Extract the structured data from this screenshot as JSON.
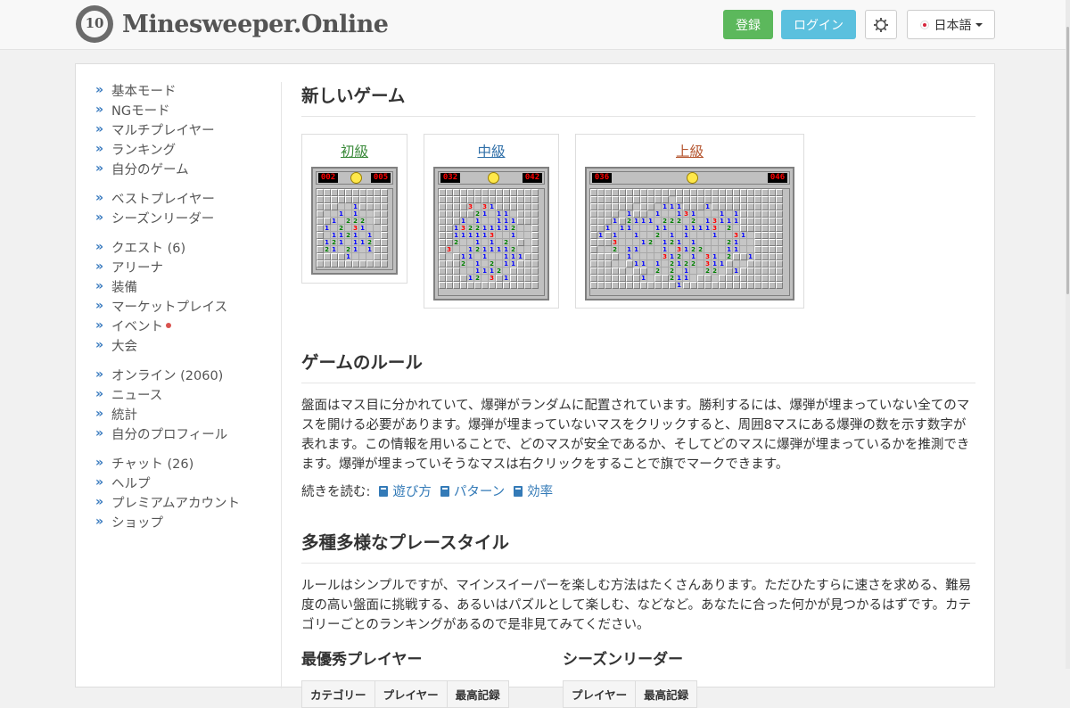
{
  "header": {
    "logo_badge": "10",
    "logo_text": "Minesweeper.Online",
    "register_label": "登録",
    "login_label": "ログイン",
    "theme_icon": "gear-icon",
    "language_label": "日本語"
  },
  "colors": {
    "register": "#5cb85c",
    "login": "#5bc0de",
    "link": "#337ab7",
    "beginner": "#3a8a3a",
    "intermediate": "#2f6fa8",
    "expert": "#b5552f"
  },
  "sidebar": {
    "groups": [
      [
        {
          "label": "基本モード"
        },
        {
          "label": "NGモード"
        },
        {
          "label": "マルチプレイヤー"
        },
        {
          "label": "ランキング"
        },
        {
          "label": "自分のゲーム"
        }
      ],
      [
        {
          "label": "ベストプレイヤー"
        },
        {
          "label": "シーズンリーダー"
        }
      ],
      [
        {
          "label": "クエスト (6)"
        },
        {
          "label": "アリーナ"
        },
        {
          "label": "装備"
        },
        {
          "label": "マーケットプレイス"
        },
        {
          "label": "イベント"
        },
        {
          "label": "大会"
        }
      ],
      [
        {
          "label": "オンライン (2060)"
        },
        {
          "label": "ニュース"
        },
        {
          "label": "統計"
        },
        {
          "label": "自分のプロフィール"
        }
      ],
      [
        {
          "label": "チャット (26)"
        },
        {
          "label": "ヘルプ"
        },
        {
          "label": "プレミアムアカウント"
        },
        {
          "label": "ショップ"
        }
      ]
    ]
  },
  "new_game": {
    "title": "新しいゲーム",
    "beginner": {
      "label": "初級",
      "mines": "002",
      "timer": "005"
    },
    "intermediate": {
      "label": "中級",
      "mines": "032",
      "timer": "042"
    },
    "expert": {
      "label": "上級",
      "mines": "036",
      "timer": "046"
    }
  },
  "rules": {
    "title": "ゲームのルール",
    "text": "盤面はマス目に分かれていて、爆弾がランダムに配置されています。勝利するには、爆弾が埋まっていない全てのマスを開ける必要があります。爆弾が埋まっていないマスをクリックすると、周囲8マスにある爆弾の数を示す数字が表れます。この情報を用いることで、どのマスが安全であるか、そしてどのマスに爆弾が埋まっているかを推測できます。爆弾が埋まっていそうなマスは右クリックをすることで旗でマークできます。",
    "read_more_label": "続きを読む:",
    "links": [
      "遊び方",
      "パターン",
      "効率"
    ]
  },
  "styles": {
    "title": "多種多様なプレースタイル",
    "text": "ルールはシンプルですが、マインスイーパーを楽しむ方法はたくさんあります。ただひたすらに速さを求める、難易度の高い盤面に挑戦する、あるいはパズルとして楽しむ、などなど。あなたに合った何かが見つかるはずです。カテゴリーごとのランキングがあるので是非見てみてください。"
  },
  "best_players": {
    "title": "最優秀プレイヤー",
    "headers": [
      "カテゴリー",
      "プレイヤー",
      "最高記録"
    ]
  },
  "season_leaders": {
    "title": "シーズンリーダー",
    "headers": [
      "プレイヤー",
      "最高記録"
    ]
  }
}
